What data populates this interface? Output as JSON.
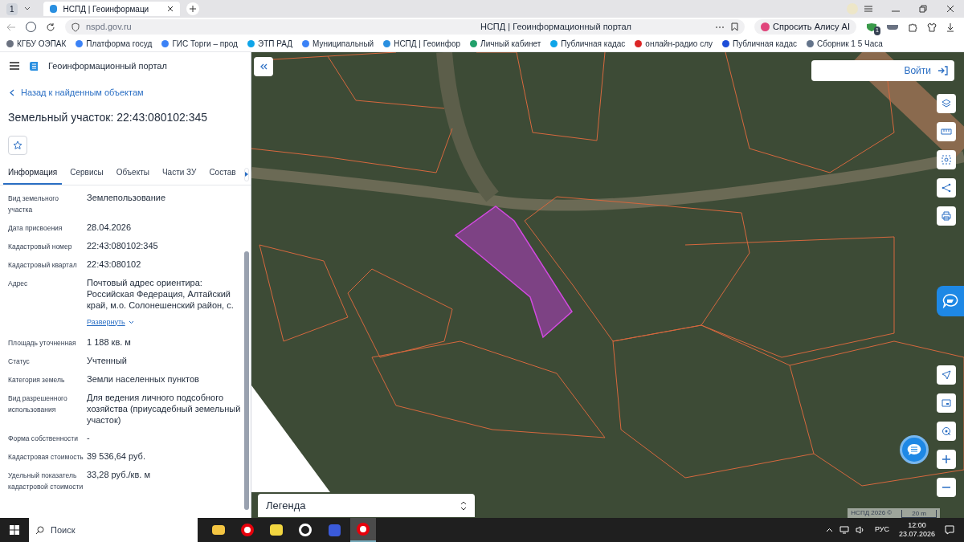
{
  "browser": {
    "tab_count": "1",
    "tabs": [
      {
        "title": "НСПД | Геоинформаци",
        "selected": true
      }
    ],
    "address": "nspd.gov.ru",
    "page_title": "НСПД | Геоинформационный портал",
    "alice_button": "Спросить Алису AI",
    "extension_badge": "1",
    "bookmarks": [
      "КГБУ ОЭПАК",
      "Платформа госуд",
      "ГИС Торги – прод",
      "ЭТП РАД",
      "Муниципальный",
      "НСПД | Геоинфор",
      "Личный кабинет",
      "Публичная кадас",
      "онлайн-радио слу",
      "Публичная кадас",
      "Сборник 1 5 Часа"
    ]
  },
  "panel": {
    "app_title": "Геоинформационный портал",
    "back_link": "Назад к найденным объектам",
    "heading": "Земельный участок: 22:43:080102:345",
    "tabs": [
      {
        "label": "Информация",
        "selected": true
      },
      {
        "label": "Сервисы",
        "selected": false
      },
      {
        "label": "Объекты",
        "selected": false
      },
      {
        "label": "Части ЗУ",
        "selected": false
      },
      {
        "label": "Состав",
        "selected": false
      }
    ],
    "fields": [
      {
        "label": "Вид земельного участка",
        "value": "Землепользование"
      },
      {
        "label": "Дата присвоения",
        "value": "28.04.2026"
      },
      {
        "label": "Кадастровый номер",
        "value": "22:43:080102:345"
      },
      {
        "label": "Кадастровый квартал",
        "value": "22:43:080102"
      },
      {
        "label": "Адрес",
        "value": "Почтовый адрес ориентира: Российская Федерация, Алтайский край, м.о. Солонешенский район, с.",
        "expand_link": "Развернуть"
      },
      {
        "label": "Площадь уточненная",
        "value": "1 188 кв. м"
      },
      {
        "label": "Статус",
        "value": "Учтенный"
      },
      {
        "label": "Категория земель",
        "value": "Земли населенных пунктов"
      },
      {
        "label": "Вид разрешенного использования",
        "value": "Для ведения личного подсобного хозяйства (приусадебный земельный участок)"
      },
      {
        "label": "Форма собственности",
        "value": "-"
      },
      {
        "label": "Кадастровая стоимость",
        "value": "39 536,64 руб."
      },
      {
        "label": "Удельный показатель кадастровой стоимости",
        "value": "33,28 руб./кв. м"
      }
    ]
  },
  "map": {
    "login_button": "Войти",
    "legend": "Легенда",
    "attribution": "НСПД 2026 ©",
    "scale": "20 m"
  },
  "taskbar": {
    "search": "Поиск",
    "language": "РУС",
    "time": "12:00",
    "date": "23.07.2026"
  }
}
